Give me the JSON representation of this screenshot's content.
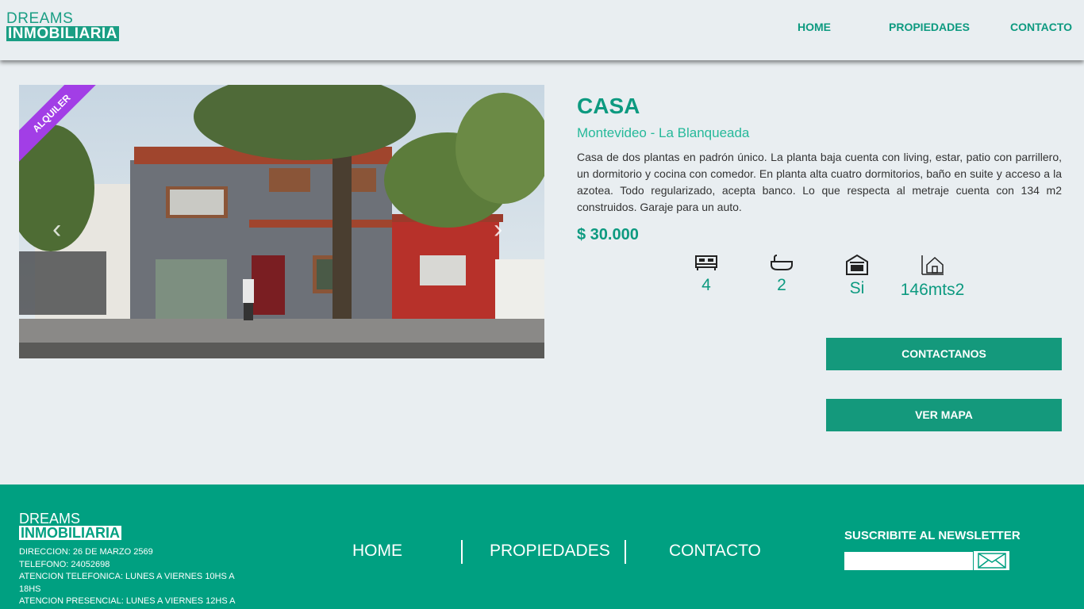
{
  "header": {
    "logo_line1": "DREAMS",
    "logo_line2": "INMOBILIARIA",
    "nav": [
      "HOME",
      "PROPIEDADES",
      "CONTACTO"
    ]
  },
  "listing": {
    "badge": "ALQUILER",
    "title": "CASA",
    "location": "Montevideo - La Blanqueada",
    "description": "Casa de dos plantas en padrón único. La planta baja cuenta con living, estar, patio con parrillero, un dormitorio y cocina con comedor. En planta alta cuatro dormitorios, baño en suite y acceso a la azotea. Todo regularizado, acepta banco. Lo que respecta al metraje cuenta con 134 m2 construidos. Garaje para un auto.",
    "price": "$ 30.000",
    "features": [
      {
        "icon": "bed-icon",
        "value": "4"
      },
      {
        "icon": "bathtub-icon",
        "value": "2"
      },
      {
        "icon": "garage-icon",
        "value": "Si"
      },
      {
        "icon": "house-area-icon",
        "value": "146mts2"
      }
    ],
    "contact_button": "CONTACTANOS",
    "map_button": "VER MAPA"
  },
  "footer": {
    "logo_line1": "DREAMS",
    "logo_line2": "INMOBILIARIA",
    "info": [
      "DIRECCION: 26 DE MARZO 2569",
      "TELEFONO: 24052698",
      "ATENCION TELEFONICA: LUNES A VIERNES 10HS A 18HS",
      "ATENCION PRESENCIAL: LUNES A VIERNES 12HS A"
    ],
    "nav": [
      "HOME",
      "PROPIEDADES",
      "CONTACTO"
    ],
    "newsletter_title": "SUSCRIBITE AL NEWSLETTER",
    "newsletter_placeholder": ""
  },
  "colors": {
    "accent": "#0d9a80",
    "footer_bg": "#00a081",
    "badge": "#a23ee6",
    "page_bg": "#e9eef1"
  }
}
